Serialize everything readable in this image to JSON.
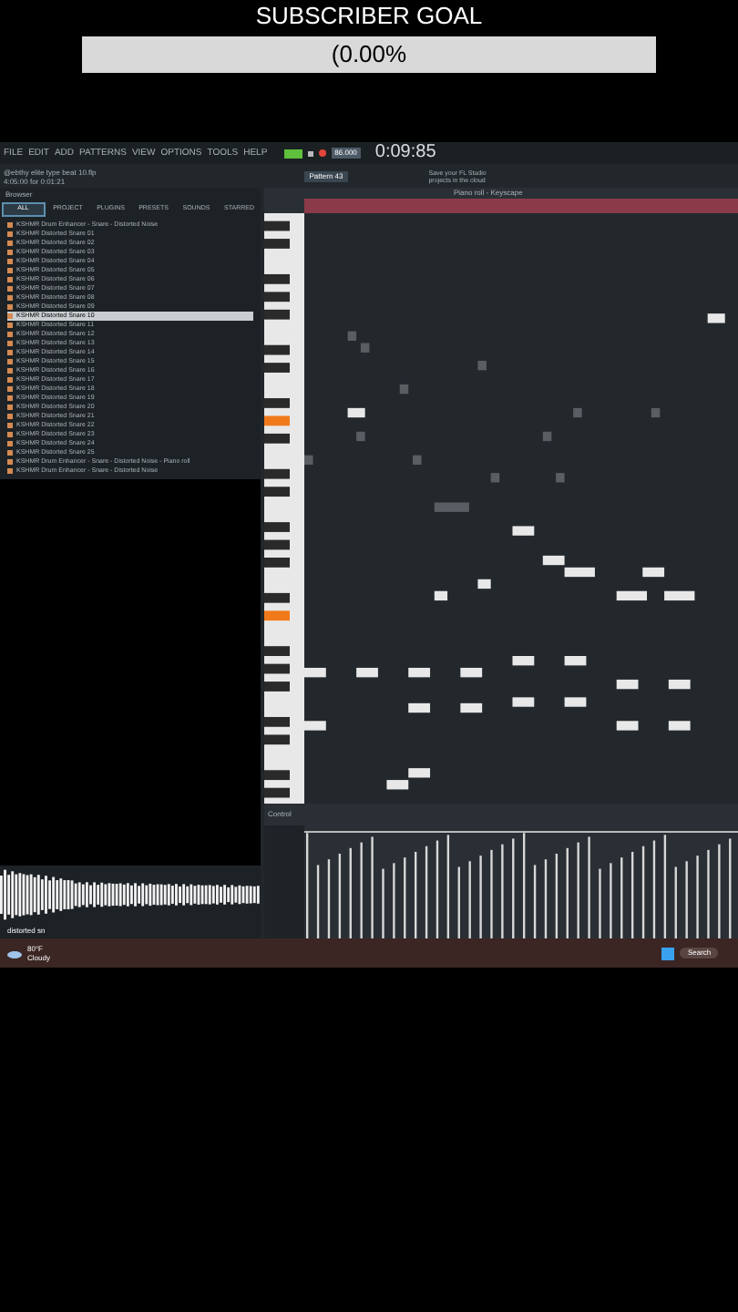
{
  "overlay": {
    "title": "SUBSCRIBER GOAL",
    "progress": "(0.00%",
    "level": 0.0
  },
  "menu": [
    "FILE",
    "EDIT",
    "ADD",
    "PATTERNS",
    "VIEW",
    "OPTIONS",
    "TOOLS",
    "HELP"
  ],
  "transport": {
    "time": "0:09:85",
    "tempo": "86.000",
    "recording": true
  },
  "project": {
    "file": "@ebthy elite type beat 10.flp",
    "position": "4:05:00 for 0:01:21",
    "pattern": "Pattern 43",
    "hint": "Save your FL Studio projects in the cloud"
  },
  "browser": {
    "title": "Browser",
    "tabs": [
      {
        "label": "ALL",
        "selected": true
      },
      {
        "label": "PROJECT",
        "selected": false
      },
      {
        "label": "PLUGINS",
        "selected": false
      },
      {
        "label": "PRESETS",
        "selected": false
      },
      {
        "label": "SOUNDS",
        "selected": false
      },
      {
        "label": "STARRED",
        "selected": false
      }
    ],
    "items": [
      {
        "label": "KSHMR Drum Enhancer - Snare - Distorted Noise",
        "selected": false
      },
      {
        "label": "KSHMR Distorted Snare 01",
        "selected": false
      },
      {
        "label": "KSHMR Distorted Snare 02",
        "selected": false
      },
      {
        "label": "KSHMR Distorted Snare 03",
        "selected": false
      },
      {
        "label": "KSHMR Distorted Snare 04",
        "selected": false
      },
      {
        "label": "KSHMR Distorted Snare 05",
        "selected": false
      },
      {
        "label": "KSHMR Distorted Snare 06",
        "selected": false
      },
      {
        "label": "KSHMR Distorted Snare 07",
        "selected": false
      },
      {
        "label": "KSHMR Distorted Snare 08",
        "selected": false
      },
      {
        "label": "KSHMR Distorted Snare 09",
        "selected": false
      },
      {
        "label": "KSHMR Distorted Snare 10",
        "selected": true
      },
      {
        "label": "KSHMR Distorted Snare 11",
        "selected": false
      },
      {
        "label": "KSHMR Distorted Snare 12",
        "selected": false
      },
      {
        "label": "KSHMR Distorted Snare 13",
        "selected": false
      },
      {
        "label": "KSHMR Distorted Snare 14",
        "selected": false
      },
      {
        "label": "KSHMR Distorted Snare 15",
        "selected": false
      },
      {
        "label": "KSHMR Distorted Snare 16",
        "selected": false
      },
      {
        "label": "KSHMR Distorted Snare 17",
        "selected": false
      },
      {
        "label": "KSHMR Distorted Snare 18",
        "selected": false
      },
      {
        "label": "KSHMR Distorted Snare 19",
        "selected": false
      },
      {
        "label": "KSHMR Distorted Snare 20",
        "selected": false
      },
      {
        "label": "KSHMR Distorted Snare 21",
        "selected": false
      },
      {
        "label": "KSHMR Distorted Snare 22",
        "selected": false
      },
      {
        "label": "KSHMR Distorted Snare 23",
        "selected": false
      },
      {
        "label": "KSHMR Distorted Snare 24",
        "selected": false
      },
      {
        "label": "KSHMR Distorted Snare 25",
        "selected": false
      },
      {
        "label": "KSHMR Drum Enhancer - Snare - Distorted Noise - Piano roll",
        "selected": false
      },
      {
        "label": "KSHMR Drum Enhancer - Snare - Distorted Noise",
        "selected": false
      }
    ],
    "preview": {
      "name": "distorted sn"
    }
  },
  "piano_roll": {
    "title": "Piano roll - Keyscape",
    "control": "Control"
  },
  "taskbar": {
    "temperature": "80°F",
    "weather": "Cloudy",
    "search": "Search"
  }
}
